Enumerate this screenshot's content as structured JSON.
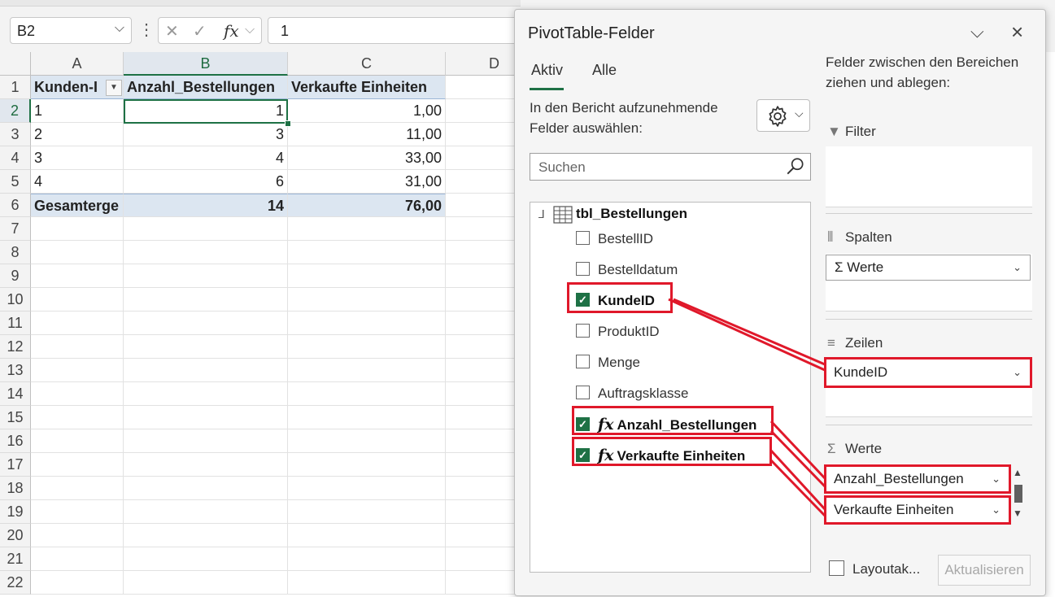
{
  "formula_bar": {
    "name_box": "B2",
    "formula_value": "1",
    "fx_symbol": "fx"
  },
  "sheet": {
    "columns": [
      "A",
      "B",
      "C",
      "D"
    ],
    "rows": [
      "1",
      "2",
      "3",
      "4",
      "5",
      "6",
      "7",
      "8",
      "9",
      "10",
      "11",
      "12",
      "13",
      "14",
      "15",
      "16",
      "17",
      "18",
      "19",
      "20",
      "21",
      "22"
    ],
    "header": [
      "Kunden-I",
      "Anzahl_Bestellungen",
      "Verkaufte Einheiten"
    ],
    "data": [
      [
        "1",
        "1",
        "1,00"
      ],
      [
        "2",
        "3",
        "11,00"
      ],
      [
        "3",
        "4",
        "33,00"
      ],
      [
        "4",
        "6",
        "31,00"
      ]
    ],
    "total": [
      "Gesamterge",
      "14",
      "76,00"
    ]
  },
  "pane": {
    "title": "PivotTable-Felder",
    "tabs": [
      "Aktiv",
      "Alle"
    ],
    "choose_text": "In den Bericht aufzunehmende Felder auswählen:",
    "search_placeholder": "Suchen",
    "table_name": "tbl_Bestellungen",
    "fields": [
      {
        "label": "BestellID",
        "checked": false
      },
      {
        "label": "Bestelldatum",
        "checked": false
      },
      {
        "label": "KundeID",
        "checked": true
      },
      {
        "label": "ProduktID",
        "checked": false
      },
      {
        "label": "Menge",
        "checked": false
      },
      {
        "label": "Auftragsklasse",
        "checked": false
      },
      {
        "label": "Anzahl_Bestellungen",
        "checked": true
      },
      {
        "label": "Verkaufte Einheiten",
        "checked": true
      }
    ],
    "area_hint": "Felder zwischen den Bereichen ziehen und ablegen:",
    "areas": {
      "filter": "Filter",
      "columns": "Spalten",
      "columns_items": [
        "Σ Werte"
      ],
      "rows": "Zeilen",
      "rows_items": [
        "KundeID"
      ],
      "values": "Werte",
      "values_items": [
        "Anzahl_Bestellungen",
        "Verkaufte Einheiten"
      ]
    },
    "layout_label": "Layoutak...",
    "update_label": "Aktualisieren"
  },
  "colors": {
    "accent": "#1e7145",
    "highlight_red": "#e0182a",
    "pivot_header_bg": "#dce6f1"
  }
}
